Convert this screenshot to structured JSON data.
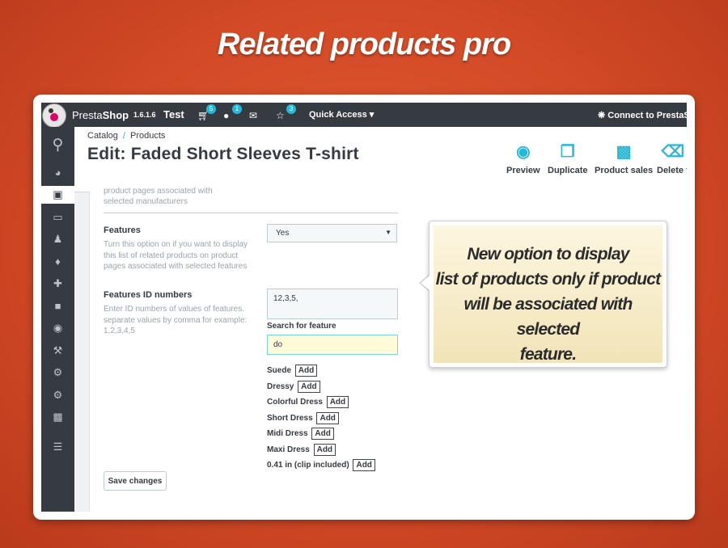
{
  "banner": {
    "title": "Related products pro"
  },
  "topbar": {
    "brand_a": "Presta",
    "brand_b": "Shop",
    "version": "1.6.1.6",
    "shop_name": "Test",
    "cart_badge": "5",
    "customers_badge": "1",
    "trophy_badge": "3",
    "quick_access": "Quick Access ▾",
    "connect": "Connect to PrestaShop"
  },
  "breadcrumb": {
    "catalog": "Catalog",
    "separator": "/",
    "products": "Products"
  },
  "page": {
    "title": "Edit: Faded Short Sleeves T-shirt"
  },
  "toolbar": {
    "preview": "Preview",
    "duplicate": "Duplicate",
    "product_sales": "Product sales",
    "delete": "Delete t"
  },
  "form": {
    "prev_help_1": "product pages associated with",
    "prev_help_2": "selected manufacturers",
    "features_label": "Features",
    "features_help": "Turn this option on if you want to display this list of related products on product pages associated with selected features",
    "features_value": "Yes",
    "feature_ids_label": "Features ID numbers",
    "feature_ids_help": "Enter ID numbers of values of features. separate values by comma for example: 1,2,3,4,5",
    "feature_ids_value": "12,3,5,",
    "search_label": "Search for feature",
    "search_value": "do",
    "add_label": "Add",
    "results": [
      "Suede",
      "Dressy",
      "Colorful Dress",
      "Short Dress",
      "Midi Dress",
      "Maxi Dress",
      "0.41 in (clip included)"
    ],
    "save": "Save changes"
  },
  "callout": {
    "line1": "New option to display",
    "line2": "list of products only if product",
    "line3": "will be associated with selected",
    "line4": "feature."
  },
  "colors": {
    "accent": "#25b9d7",
    "dark": "#363a41",
    "background": "#d34a26"
  }
}
